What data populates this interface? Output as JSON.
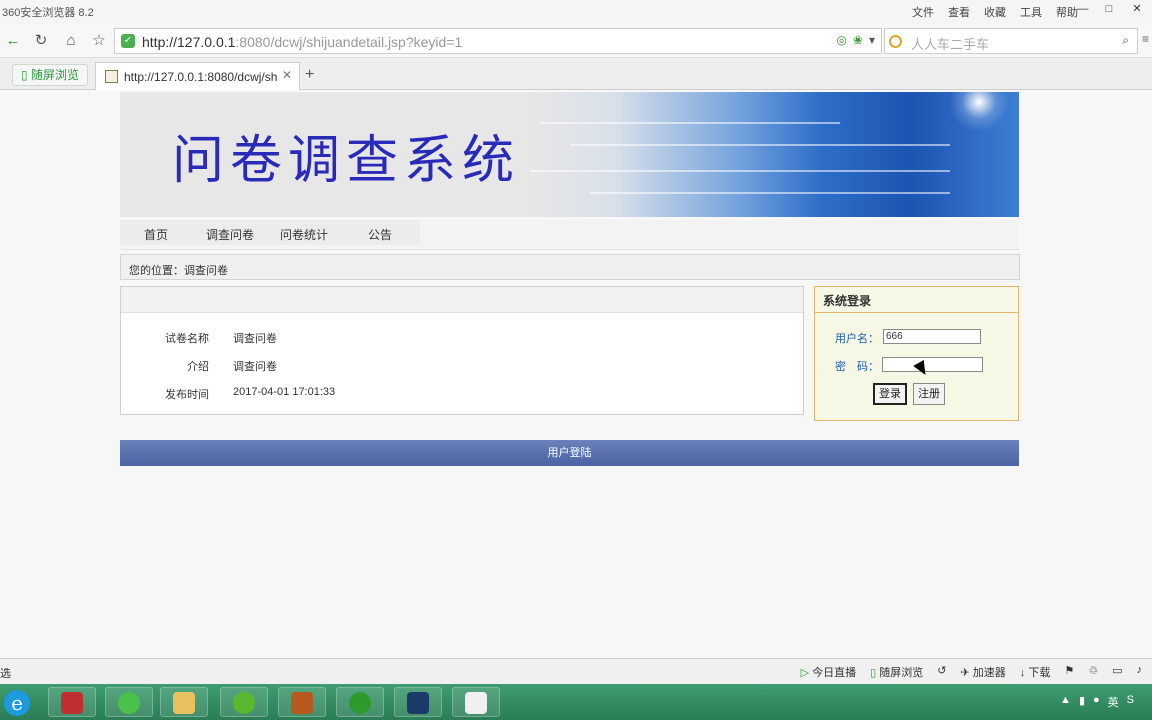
{
  "browser": {
    "app_title": "360安全浏览器 8.2",
    "menu": [
      "文件",
      "查看",
      "收藏",
      "工具",
      "帮助"
    ],
    "url_host": "http://127.0.0.1",
    "url_rest": ":8080/dcwj/shijuandetail.jsp?keyid=1",
    "search_placeholder": "人人车二手车",
    "side_tab_label": "随屏浏览",
    "active_tab_title": "http://127.0.0.1:8080/dcwj/sh",
    "status_left": "选",
    "status_items": [
      "今日直播",
      "随屏浏览",
      "加速器",
      "下载"
    ]
  },
  "header": {
    "banner_title": "问卷调查系统"
  },
  "nav": {
    "items": [
      "首页",
      "调查问卷",
      "问卷统计",
      "公告"
    ]
  },
  "breadcrumb": {
    "text": "您的位置：调查问卷"
  },
  "detail": {
    "rows": [
      {
        "label": "试卷名称",
        "value": "调查问卷"
      },
      {
        "label": "介绍",
        "value": "调查问卷"
      },
      {
        "label": "发布时间",
        "value": "2017-04-01 17:01:33"
      }
    ]
  },
  "login": {
    "title": "系统登录",
    "username_label": "用户名：",
    "username_value": "666",
    "password_label": "密　码：",
    "login_button": "登录",
    "register_button": "注册"
  },
  "footer": {
    "text": "用户登陆"
  },
  "taskbar": {
    "tray_lang": "英"
  }
}
